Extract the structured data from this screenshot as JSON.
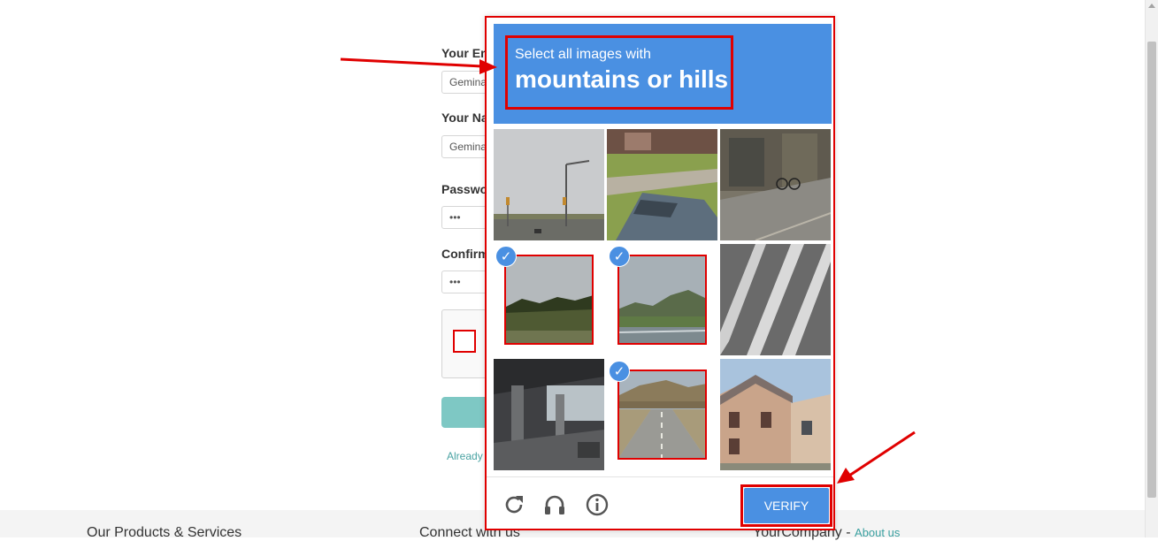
{
  "form": {
    "email_label": "Your Em",
    "email_value": "Gemina",
    "name_label": "Your Na",
    "name_value": "Gemina",
    "password_label": "Passwo",
    "password_value": "•••",
    "confirm_label": "Confirm",
    "confirm_value": "•••",
    "already_text": "Already"
  },
  "footer": {
    "products": "Our Products & Services",
    "connect": "Connect with us",
    "company": "YourCompany - ",
    "about_link": "About us"
  },
  "challenge": {
    "prompt_small": "Select all images with",
    "prompt_big": "mountains or hills",
    "verify_label": "VERIFY",
    "accent_color": "#4a90e2",
    "annotation_color": "#e00000",
    "tiles": [
      {
        "name": "tile-1-road-traffic-lights",
        "selected": false
      },
      {
        "name": "tile-2-parked-car",
        "selected": false
      },
      {
        "name": "tile-3-storefront-bicycle",
        "selected": false
      },
      {
        "name": "tile-4-field-trees",
        "selected": true
      },
      {
        "name": "tile-5-hills-highway",
        "selected": true
      },
      {
        "name": "tile-6-crosswalk",
        "selected": false
      },
      {
        "name": "tile-7-overpass",
        "selected": false
      },
      {
        "name": "tile-8-mountain-road",
        "selected": true
      },
      {
        "name": "tile-9-house",
        "selected": false
      }
    ],
    "footer_icons": [
      "reload-icon",
      "headphones-icon",
      "info-icon"
    ]
  }
}
